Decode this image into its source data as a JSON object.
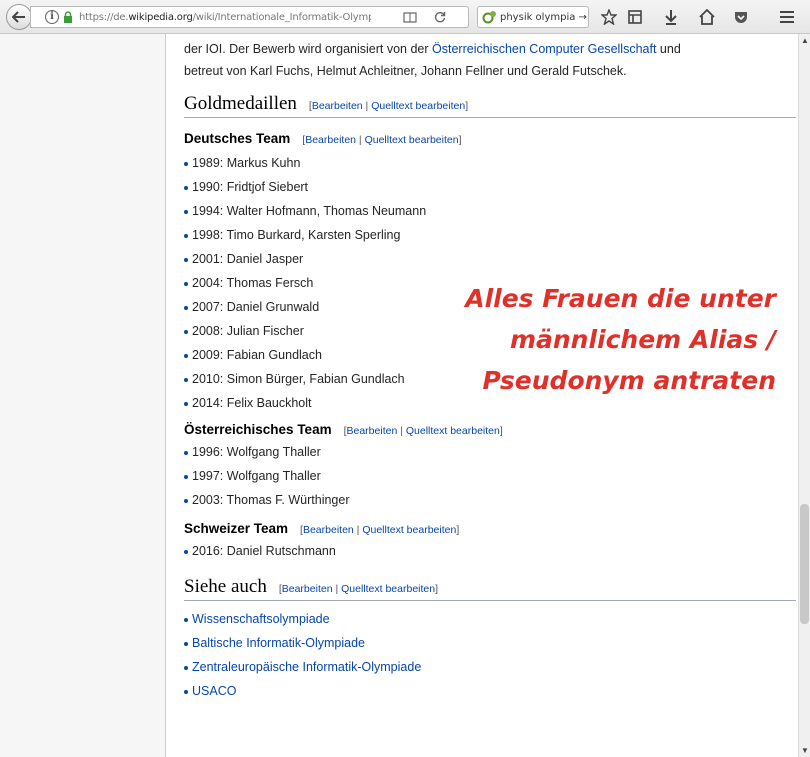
{
  "browser": {
    "url_prefix": "https://de.",
    "url_domain": "wikipedia.org",
    "url_path": "/wiki/Internationale_Informatik-Olymp",
    "search_text": "physik olympia →"
  },
  "intro": {
    "line1_pre": "der IOI. Der Bewerb wird organisiert von der ",
    "line1_link": "Österreichischen Computer Gesellschaft",
    "line1_post": " und",
    "line2": "betreut von Karl Fuchs, Helmut Achleitner, Johann Fellner und Gerald Futschek."
  },
  "edit": {
    "open": "[",
    "edit_label": "Bearbeiten",
    "sep": " | ",
    "source_label": "Quelltext bearbeiten",
    "close": "]"
  },
  "gold": {
    "heading": "Goldmedaillen",
    "german": {
      "heading": "Deutsches Team",
      "items": [
        "1989: Markus Kuhn",
        "1990: Fridtjof Siebert",
        "1994: Walter Hofmann, Thomas Neumann",
        "1998: Timo Burkard, Karsten Sperling",
        "2001: Daniel Jasper",
        "2004: Thomas Fersch",
        "2007: Daniel Grunwald",
        "2008: Julian Fischer",
        "2009: Fabian Gundlach",
        "2010: Simon Bürger, Fabian Gundlach",
        "2014: Felix Bauckholt"
      ]
    },
    "austrian": {
      "heading": "Österreichisches Team",
      "items": [
        "1996: Wolfgang Thaller",
        "1997: Wolfgang Thaller",
        "2003: Thomas F. Würthinger"
      ]
    },
    "swiss": {
      "heading": "Schweizer Team",
      "items": [
        "2016: Daniel Rutschmann"
      ]
    }
  },
  "see_also": {
    "heading": "Siehe auch",
    "items": [
      "Wissenschaftsolympiade",
      "Baltische Informatik-Olympiade",
      "Zentraleuropäische Informatik-Olympiade",
      "USACO"
    ]
  },
  "annotation": {
    "line1": "Alles Frauen die unter",
    "line2": "männlichem Alias /",
    "line3": "Pseudonym antraten",
    "color": "#e0302a"
  }
}
